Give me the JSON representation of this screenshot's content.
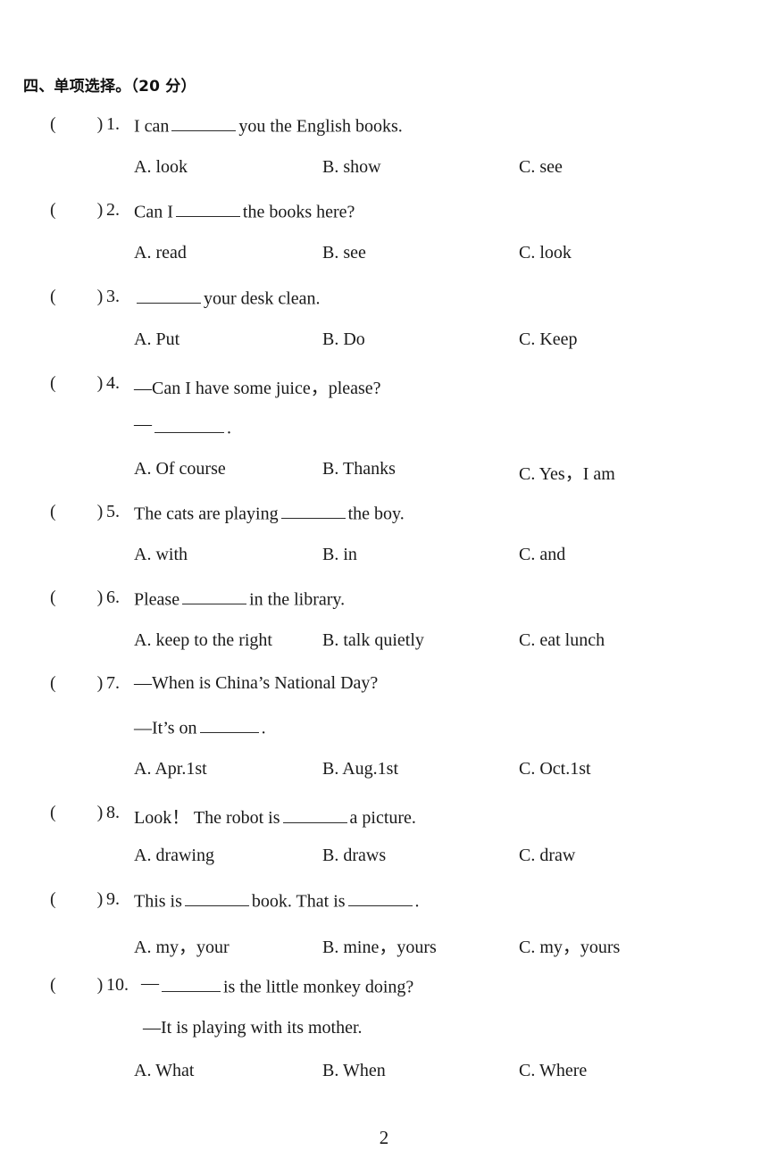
{
  "document": {
    "section_heading": "四、单项选择。（20 分）",
    "page_number": "2"
  },
  "questions": [
    {
      "paren_open": "(",
      "paren_close": ")",
      "number": "1.",
      "stem_before": "I can",
      "stem_after": "you the English books.",
      "options": {
        "a": "A. look",
        "b": "B. show",
        "c": "C. see"
      }
    },
    {
      "paren_open": "(",
      "paren_close": ")",
      "number": "2.",
      "stem_before": "Can I",
      "stem_after": "the books here?",
      "options": {
        "a": "A. read",
        "b": "B. see",
        "c": "C. look"
      }
    },
    {
      "paren_open": "(",
      "paren_close": ")",
      "number": "3.",
      "stem_before": "",
      "stem_after": "your desk clean.",
      "options": {
        "a": "A. Put",
        "b": "B. Do",
        "c": "C. Keep"
      }
    },
    {
      "paren_open": "(",
      "paren_close": ")",
      "number": "4.",
      "stem_line1": "—Can I have some juice，please?",
      "stem_line2_dash": "—",
      "stem_line2_after": ".",
      "options": {
        "a": "A. Of course",
        "b": "B. Thanks",
        "c": "C. Yes，I am"
      }
    },
    {
      "paren_open": "(",
      "paren_close": ")",
      "number": "5.",
      "stem_before": "The cats are playing",
      "stem_after": "the boy.",
      "options": {
        "a": "A. with",
        "b": "B. in",
        "c": "C. and"
      }
    },
    {
      "paren_open": "(",
      "paren_close": ")",
      "number": "6.",
      "stem_before": "Please",
      "stem_after": "in the library.",
      "options": {
        "a": "A. keep to the right",
        "b": "B. talk quietly",
        "c": "C. eat lunch"
      }
    },
    {
      "paren_open": "(",
      "paren_close": ")",
      "number": "7.",
      "stem_line1": "—When is China’s National Day?",
      "stem_line2_before": "—It’s on",
      "stem_line2_after": ".",
      "options": {
        "a": "A. Apr.1st",
        "b": "B. Aug.1st",
        "c": "C. Oct.1st"
      }
    },
    {
      "paren_open": "(",
      "paren_close": ")",
      "number": "8.",
      "stem_before": "Look！ The robot is",
      "stem_after": "a picture.",
      "options": {
        "a": "A. drawing",
        "b": "B. draws",
        "c": "C. draw"
      }
    },
    {
      "paren_open": "(",
      "paren_close": ")",
      "number": "9.",
      "stem_before": "This is",
      "stem_middle": "book. That is",
      "stem_after": ".",
      "options": {
        "a": "A. my，your",
        "b": "B. mine，yours",
        "c": "C. my，yours"
      }
    },
    {
      "paren_open": "(",
      "paren_close": ")",
      "number": "10.",
      "stem_line1_dash": "—",
      "stem_line1_after": "is the little monkey doing?",
      "stem_line2": "—It is playing with its mother.",
      "options": {
        "a": "A. What",
        "b": "B. When",
        "c": "C. Where"
      }
    }
  ]
}
